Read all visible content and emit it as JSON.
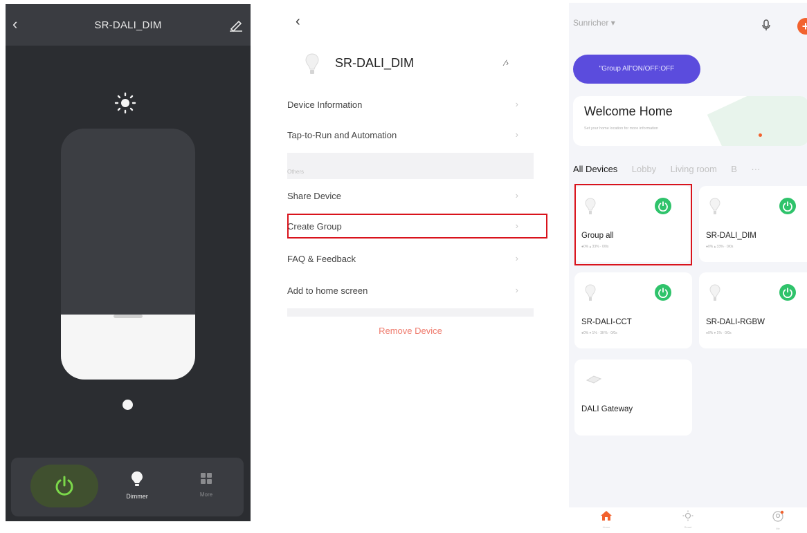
{
  "panel1": {
    "title": "SR-DALI_DIM",
    "brightness_fraction": 0.26,
    "tabs": [
      {
        "label": "",
        "icon": "power-icon",
        "active": true
      },
      {
        "label": "Dimmer",
        "icon": "bulb-icon",
        "active": true
      },
      {
        "label": "More",
        "icon": "grid-icon",
        "active": false
      }
    ]
  },
  "panel2": {
    "device_name": "SR-DALI_DIM",
    "rows_top": [
      "Device Information",
      "Tap-to-Run and Automation"
    ],
    "section_label": "Others",
    "rows_bottom": [
      "Share Device",
      "Create Group",
      "FAQ & Feedback",
      "Add to home screen"
    ],
    "remove_label": "Remove Device"
  },
  "panel3": {
    "home_name": "Sunricher ▾",
    "scene_pill": "\"Group All\"ON/OFF:OFF",
    "welcome": {
      "title": "Welcome Home",
      "subtitle": "Set your home location for more information"
    },
    "tabs": [
      "All Devices",
      "Lobby",
      "Living room",
      "B",
      "···"
    ],
    "devices": [
      {
        "name": "Group all",
        "status": "●0%  ▴ 33%  ·  0/0s",
        "powered": true
      },
      {
        "name": "SR-DALI_DIM",
        "status": "●0%  ▴ 33%  ·  0/0s",
        "powered": true
      },
      {
        "name": "SR-DALI-CCT",
        "status": "●0%  ▾ 1%  ·  3K%  ·  0/0s",
        "powered": true
      },
      {
        "name": "SR-DALI-RGBW",
        "status": "●0%  ▾ 1%  ·  0/0s",
        "powered": true
      },
      {
        "name": "DALI Gateway",
        "status": "",
        "powered": false
      }
    ],
    "nav": [
      {
        "label": "Home",
        "icon": "home-icon"
      },
      {
        "label": "Smart",
        "icon": "sun-icon"
      },
      {
        "label": "Me",
        "icon": "profile-icon"
      }
    ],
    "colors": {
      "accent": "#5b4cdd",
      "power_on": "#2fc36b",
      "alert": "#f2622e",
      "highlight": "#d9131c"
    }
  }
}
